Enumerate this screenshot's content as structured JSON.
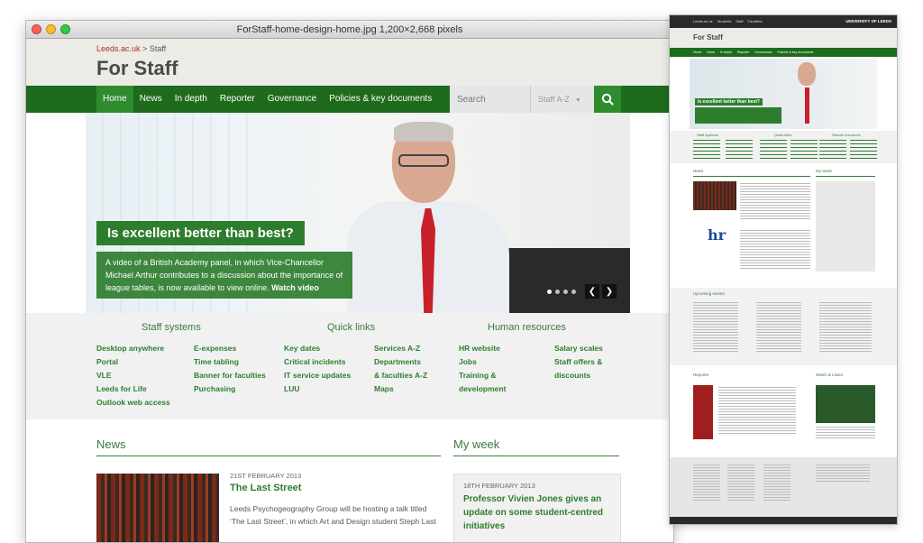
{
  "window": {
    "title": "ForStaff-home-design-home.jpg 1,200×2,668 pixels"
  },
  "header": {
    "breadcrumb_link": "Leeds.ac.uk",
    "breadcrumb_sep": " > ",
    "breadcrumb_current": "Staff",
    "site_title": "For Staff"
  },
  "nav": {
    "items": [
      "Home",
      "News",
      "In depth",
      "Reporter",
      "Governance",
      "Policies & key documents"
    ],
    "search_placeholder": "Search",
    "staff_az": "Staff A-Z"
  },
  "hero": {
    "heading": "Is excellent better than best?",
    "text": "A video of a British Academy panel, in which Vice-Chancellor Michael Arthur contributes to a discussion about the importance of league tables, is now available to view online.",
    "link": "Watch video"
  },
  "quick_links": {
    "staff_systems": {
      "heading": "Staff systems",
      "col1": [
        "Desktop anywhere",
        "Portal",
        "VLE",
        "Leeds for Life",
        "Outlook web access"
      ],
      "col2": [
        "E-expenses",
        "Time tabling",
        "Banner for faculties",
        "Purchasing"
      ]
    },
    "quick": {
      "heading": "Quick links",
      "col1": [
        "Key dates",
        "Critical incidents",
        "IT service updates",
        "LUU"
      ],
      "col2": [
        "Services A-Z",
        "Departments",
        "& faculties A-Z",
        "Maps"
      ]
    },
    "hr": {
      "heading": "Human resources",
      "col1": [
        "HR website",
        "Jobs",
        "Training &",
        "development"
      ],
      "col2": [
        "Salary scales",
        "Staff offers &",
        "discounts"
      ]
    }
  },
  "news": {
    "heading": "News",
    "date": "21ST FEBRUARY 2013",
    "title": "The Last Street",
    "body": "Leeds Psychogeography Group will be hosting a talk titled ‘The Last Street’, in which Art and Design student Steph Last"
  },
  "my_week": {
    "heading": "My week",
    "date": "18TH FEBRUARY 2013",
    "title": "Professor Vivien Jones gives an update on some student-centred initiatives"
  },
  "thumbnail": {
    "top_links": [
      "Leeds.ac.uk",
      "Students",
      "Staff",
      "Faculties"
    ],
    "university": "UNIVERSITY OF LEEDS",
    "title": "For Staff",
    "nav": [
      "Home",
      "News",
      "In depth",
      "Reporter",
      "Governance",
      "Policies & key documents"
    ],
    "hero_heading": "Is excellent better than best?",
    "col_heads": [
      "Staff systems",
      "Quick links",
      "Human resources"
    ],
    "news": "News",
    "my_week": "My week",
    "events": "Upcoming events",
    "reporter": "Reporter",
    "watch_listen": "Watch & Listen",
    "hr_logo": "hr"
  },
  "colors": {
    "brand_green": "#1e6b1e",
    "accent_green": "#2e7d2e",
    "link_red": "#b22b2b"
  }
}
